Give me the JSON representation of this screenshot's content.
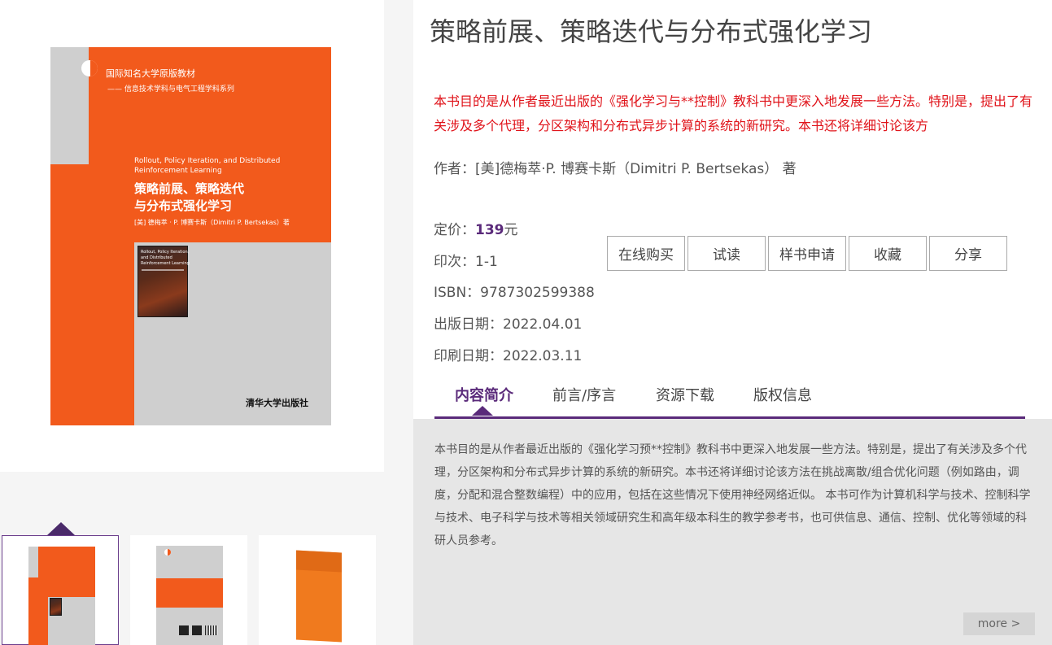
{
  "book": {
    "title": "策略前展、策略迭代与分布式强化学习",
    "summary_short": "本书目的是从作者最近出版的《强化学习与**控制》教科书中更深入地发展一些方法。特别是，提出了有关涉及多个代理，分区架构和分布式异步计算的系统的新研究。本书还将详细讨论该方",
    "author_line": "作者：[美]德梅萃·P. 博赛卡斯（Dimitri P. Bertsekas） 著",
    "price_label": "定价：",
    "price_value": "139",
    "price_unit": "元",
    "edition": "印次：1-1",
    "isbn": "ISBN：9787302599388",
    "publish_date": "出版日期：2022.04.01",
    "print_date": "印刷日期：2022.03.11"
  },
  "actions": {
    "buy": "在线购买",
    "trial": "试读",
    "sample": "样书申请",
    "favorite": "收藏",
    "share": "分享"
  },
  "tabs": {
    "intro": "内容简介",
    "preface": "前言/序言",
    "resources": "资源下载",
    "copyright": "版权信息"
  },
  "content": {
    "intro_text": "本书目的是从作者最近出版的《强化学习预**控制》教科书中更深入地发展一些方法。特别是，提出了有关涉及多个代理，分区架构和分布式异步计算的系统的新研究。本书还将详细讨论该方法在挑战离散/组合优化问题（例如路由，调度，分配和混合整数编程）中的应用，包括在这些情况下使用神经网络近似。 本书可作为计算机科学与技术、控制科学与技术、电子科学与技术等相关领域研究生和高年级本科生的教学参考书，也可供信息、通信、控制、优化等领域的科研人员参考。",
    "more": "more >"
  },
  "cover": {
    "series_cn": "国际知名大学原版教材",
    "series_sub": "—— 信息技术学科与电气工程学科系列",
    "title_en_1": "Rollout, Policy Iteration, and Distributed",
    "title_en_2": "Reinforcement Learning",
    "title_cn_1": "策略前展、策略迭代",
    "title_cn_2": "与分布式强化学习",
    "author": "[美] 德梅萃 · P. 博赛卡斯（Dimitri P. Bertsekas）著",
    "inset_1": "Rollout, Policy Iteration,",
    "inset_2": "and Distributed",
    "inset_3": "Reinforcement Learning",
    "publisher": "清华大学出版社"
  },
  "colors": {
    "accent": "#5a2a7a",
    "red_text": "#e0131a",
    "cover_orange": "#f25a1c"
  }
}
